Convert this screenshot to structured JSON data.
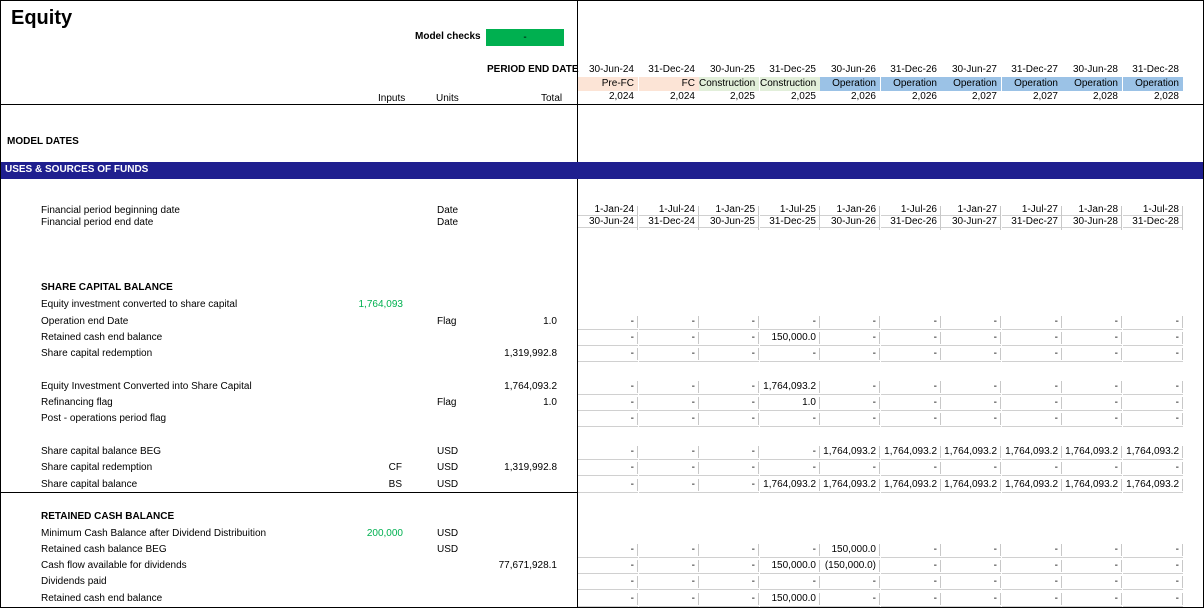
{
  "sheet": {
    "title": "Equity",
    "model_checks_label": "Model checks",
    "model_checks_value": "-",
    "model_checks_color": "#00b050",
    "period_end_label": "PERIOD END DATE",
    "col_inputs": "Inputs",
    "col_units": "Units",
    "col_total": "Total"
  },
  "periods": [
    {
      "end": "30-Jun-24",
      "phase": "Pre-FC",
      "year": "2,024",
      "begin": "1-Jan-24"
    },
    {
      "end": "31-Dec-24",
      "phase": "FC",
      "year": "2,024",
      "begin": "1-Jul-24"
    },
    {
      "end": "30-Jun-25",
      "phase": "Construction",
      "year": "2,025",
      "begin": "1-Jan-25"
    },
    {
      "end": "31-Dec-25",
      "phase": "Construction",
      "year": "2,025",
      "begin": "1-Jul-25"
    },
    {
      "end": "30-Jun-26",
      "phase": "Operation",
      "year": "2,026",
      "begin": "1-Jan-26"
    },
    {
      "end": "31-Dec-26",
      "phase": "Operation",
      "year": "2,026",
      "begin": "1-Jul-26"
    },
    {
      "end": "30-Jun-27",
      "phase": "Operation",
      "year": "2,027",
      "begin": "1-Jan-27"
    },
    {
      "end": "31-Dec-27",
      "phase": "Operation",
      "year": "2,027",
      "begin": "1-Jul-27"
    },
    {
      "end": "30-Jun-28",
      "phase": "Operation",
      "year": "2,028",
      "begin": "1-Jan-28"
    },
    {
      "end": "31-Dec-28",
      "phase": "Operation",
      "year": "2,028",
      "begin": "1-Jul-28"
    }
  ],
  "sections": {
    "model_dates": "MODEL DATES",
    "uses_sources": "USES & SOURCES OF FUNDS",
    "share_capital_balance": "SHARE CAPITAL BALANCE",
    "retained_cash_balance": "RETAINED CASH BALANCE"
  },
  "date_rows": [
    {
      "label": "Financial period beginning date",
      "unit": "Date"
    },
    {
      "label": "Financial period end date",
      "unit": "Date"
    }
  ],
  "share_rows": [
    {
      "label": "Equity investment converted to share capital",
      "input": "1,764,093",
      "input_green": true,
      "tag": "",
      "unit": "",
      "total": "",
      "values": []
    },
    {
      "label": "Operation end Date",
      "input": "",
      "tag": "",
      "unit": "Flag",
      "total": "1.0",
      "values": [
        "-",
        "-",
        "-",
        "-",
        "-",
        "-",
        "-",
        "-",
        "-",
        "-"
      ]
    },
    {
      "label": "Retained cash end balance",
      "input": "",
      "tag": "",
      "unit": "",
      "total": "",
      "values": [
        "-",
        "-",
        "-",
        "150,000.0",
        "-",
        "-",
        "-",
        "-",
        "-",
        "-"
      ]
    },
    {
      "label": "Share capital redemption",
      "input": "",
      "tag": "",
      "unit": "",
      "total": "1,319,992.8",
      "values": [
        "-",
        "-",
        "-",
        "-",
        "-",
        "-",
        "-",
        "-",
        "-",
        "-"
      ]
    },
    {
      "label": "Equity Investment Converted into Share Capital",
      "input": "",
      "tag": "",
      "unit": "",
      "total": "1,764,093.2",
      "values": [
        "-",
        "-",
        "-",
        "1,764,093.2",
        "-",
        "-",
        "-",
        "-",
        "-",
        "-"
      ]
    },
    {
      "label": "Refinancing flag",
      "input": "",
      "tag": "",
      "unit": "Flag",
      "total": "1.0",
      "values": [
        "-",
        "-",
        "-",
        "1.0",
        "-",
        "-",
        "-",
        "-",
        "-",
        "-"
      ]
    },
    {
      "label": "Post - operations period flag",
      "input": "",
      "tag": "",
      "unit": "",
      "total": "",
      "values": [
        "-",
        "-",
        "-",
        "-",
        "-",
        "-",
        "-",
        "-",
        "-",
        "-"
      ]
    },
    {
      "label": "Share capital balance BEG",
      "input": "",
      "tag": "",
      "unit": "USD",
      "total": "",
      "values": [
        "-",
        "-",
        "-",
        "-",
        "1,764,093.2",
        "1,764,093.2",
        "1,764,093.2",
        "1,764,093.2",
        "1,764,093.2",
        "1,764,093.2"
      ]
    },
    {
      "label": "Share capital redemption",
      "input": "",
      "tag": "CF",
      "unit": "USD",
      "total": "1,319,992.8",
      "values": [
        "-",
        "-",
        "-",
        "-",
        "-",
        "-",
        "-",
        "-",
        "-",
        "-"
      ]
    },
    {
      "label": "Share capital balance",
      "input": "",
      "tag": "BS",
      "unit": "USD",
      "total": "",
      "values": [
        "-",
        "-",
        "-",
        "1,764,093.2",
        "1,764,093.2",
        "1,764,093.2",
        "1,764,093.2",
        "1,764,093.2",
        "1,764,093.2",
        "1,764,093.2"
      ]
    }
  ],
  "cash_rows": [
    {
      "label": "Minimum Cash Balance after Dividend Distribuition",
      "input": "200,000",
      "input_green": true,
      "unit": "USD",
      "total": "",
      "values": []
    },
    {
      "label": "Retained cash balance BEG",
      "input": "",
      "unit": "USD",
      "total": "",
      "values": [
        "-",
        "-",
        "-",
        "-",
        "150,000.0",
        "-",
        "-",
        "-",
        "-",
        "-"
      ]
    },
    {
      "label": "Cash flow available for dividends",
      "input": "",
      "unit": "",
      "total": "77,671,928.1",
      "values": [
        "-",
        "-",
        "-",
        "150,000.0",
        "(150,000.0)",
        "-",
        "-",
        "-",
        "-",
        "-"
      ]
    },
    {
      "label": "Dividends paid",
      "input": "",
      "unit": "",
      "total": "",
      "values": [
        "-",
        "-",
        "-",
        "-",
        "-",
        "-",
        "-",
        "-",
        "-",
        "-"
      ]
    },
    {
      "label": "Retained cash end balance",
      "input": "",
      "unit": "",
      "total": "",
      "values": [
        "-",
        "-",
        "-",
        "150,000.0",
        "-",
        "-",
        "-",
        "-",
        "-",
        "-"
      ]
    }
  ]
}
